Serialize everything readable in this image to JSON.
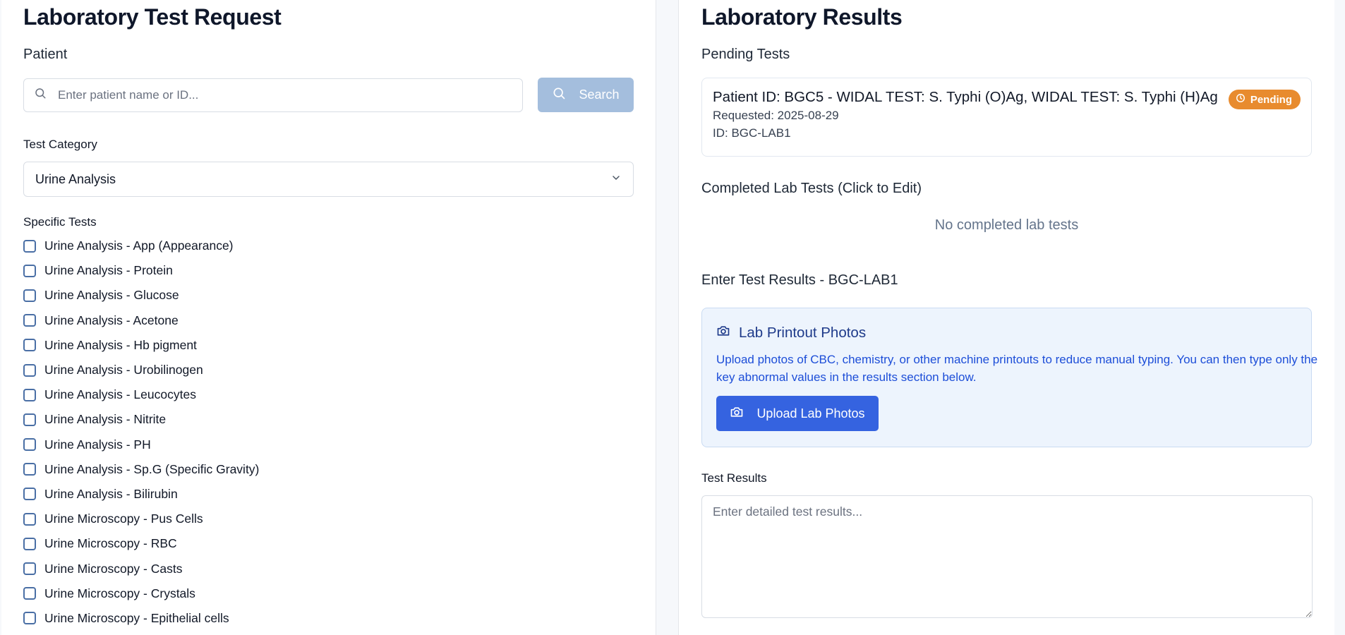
{
  "left": {
    "title": "Laboratory Test Request",
    "patient_label": "Patient",
    "search_placeholder": "Enter patient name or ID...",
    "search_button": "Search",
    "category_label": "Test Category",
    "category_value": "Urine Analysis",
    "specific_label": "Specific Tests",
    "tests": [
      "Urine Analysis - App (Appearance)",
      "Urine Analysis - Protein",
      "Urine Analysis - Glucose",
      "Urine Analysis - Acetone",
      "Urine Analysis - Hb pigment",
      "Urine Analysis - Urobilinogen",
      "Urine Analysis - Leucocytes",
      "Urine Analysis - Nitrite",
      "Urine Analysis - PH",
      "Urine Analysis - Sp.G (Specific Gravity)",
      "Urine Analysis - Bilirubin",
      "Urine Microscopy - Pus Cells",
      "Urine Microscopy - RBC",
      "Urine Microscopy - Casts",
      "Urine Microscopy - Crystals",
      "Urine Microscopy - Epithelial cells"
    ]
  },
  "right": {
    "title": "Laboratory Results",
    "pending_label": "Pending Tests",
    "pending": {
      "title": "Patient ID: BGC5 - WIDAL TEST: S. Typhi (O)Ag, WIDAL TEST: S. Typhi (H)Ag",
      "requested": "Requested: 2025-08-29",
      "id": "ID: BGC-LAB1",
      "badge": "Pending"
    },
    "completed_label": "Completed Lab Tests (Click to Edit)",
    "completed_empty": "No completed lab tests",
    "enter_label": "Enter Test Results - BGC-LAB1",
    "photo_title": "Lab Printout Photos",
    "photo_desc": "Upload photos of CBC, chemistry, or other machine printouts to reduce manual typing. You can then type only the key abnormal values in the results section below.",
    "upload_button": "Upload Lab Photos",
    "results_label": "Test Results",
    "results_placeholder": "Enter detailed test results..."
  },
  "colors": {
    "search_button_bg": "#a4bedd",
    "pending_badge": "#e88b2e",
    "upload_button_bg": "#3563e0",
    "photo_card_bg": "#edf4fd"
  },
  "icons": [
    "search-icon",
    "chevron-down-icon",
    "clock-icon",
    "camera-icon"
  ]
}
